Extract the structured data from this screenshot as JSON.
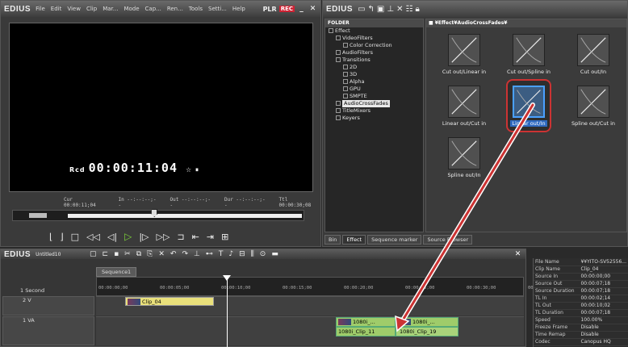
{
  "recorder": {
    "app_logo": "EDIUS",
    "menu": [
      "File",
      "Edit",
      "View",
      "Clip",
      "Mar...",
      "Mode",
      "Cap...",
      "Ren...",
      "Tools",
      "Setti...",
      "Help"
    ],
    "mode_label": "PLR",
    "rec_badge": "REC",
    "timecode_prefix": "Rcd",
    "timecode": "00:00:11:04",
    "timecode_suffix": "☆  ⏸",
    "cur": "Cur 00:00:11;04",
    "in": "In --:--:--;--",
    "out": "Out --:--:--;--",
    "dur": "Dur --:--:--;--",
    "ttl": "Ttl 00:00:30;08",
    "progress_fraction": 0.37
  },
  "effects": {
    "app_logo": "EDIUS",
    "folder_header": "FOLDER",
    "grid_header": "■ ¥Effect¥AudioCrossFades¥",
    "tree": [
      {
        "label": "Effect",
        "indent": 0
      },
      {
        "label": "VideoFilters",
        "indent": 1
      },
      {
        "label": "Color Correction",
        "indent": 2
      },
      {
        "label": "AudioFilters",
        "indent": 1
      },
      {
        "label": "Transitions",
        "indent": 1
      },
      {
        "label": "2D",
        "indent": 2
      },
      {
        "label": "3D",
        "indent": 2
      },
      {
        "label": "Alpha",
        "indent": 2
      },
      {
        "label": "GPU",
        "indent": 2
      },
      {
        "label": "SMPTE",
        "indent": 2
      },
      {
        "label": "AudioCrossFades",
        "indent": 1,
        "selected": true
      },
      {
        "label": "TitleMixers",
        "indent": 1
      },
      {
        "label": "Keyers",
        "indent": 1
      }
    ],
    "tiles": [
      {
        "label": "Cut out/Linear in"
      },
      {
        "label": "Cut out/Spline in"
      },
      {
        "label": "Cut out/In"
      },
      {
        "label": "Linear out/Cut in"
      },
      {
        "label": "Linear out/In",
        "selected": true
      },
      {
        "label": "Spline out/Cut in"
      },
      {
        "label": "Spline out/In"
      }
    ],
    "tabs": [
      "Bin",
      "Effect",
      "Sequence marker",
      "Source Browser"
    ]
  },
  "timeline": {
    "app_logo": "EDIUS",
    "project": "Untitled10",
    "sequence_tab": "Sequence1",
    "zoom": "1 Second",
    "ruler": [
      "00:00:00;00",
      "00:00:05;00",
      "00:00:10;00",
      "00:00:15;00",
      "00:00:20;00",
      "00:00:25;00",
      "00:00:30;00",
      "00:0"
    ],
    "tracks": [
      {
        "label": "2 V"
      },
      {
        "label": "1 VA"
      }
    ],
    "clips": [
      {
        "name": "Clip_04",
        "track": "2V"
      },
      {
        "name": "1080i_...",
        "track": "1VA-video-a"
      },
      {
        "name": "1080i_...",
        "track": "1VA-video-b"
      },
      {
        "name": "1080i_Clip_11",
        "track": "1VA-audio-a"
      },
      {
        "name": "1080i_Clip_19",
        "track": "1VA-audio-b"
      }
    ]
  },
  "info": [
    [
      "File Name",
      "¥¥YITO-SV52556..."
    ],
    [
      "Clip Name",
      "Clip_04"
    ],
    [
      "Source In",
      "00:00:00;00"
    ],
    [
      "Source Out",
      "00:00:07;18"
    ],
    [
      "Source Duration",
      "00:00:07;18"
    ],
    [
      "TL In",
      "00:00:02;14"
    ],
    [
      "TL Out",
      "00:00:10;02"
    ],
    [
      "TL Duration",
      "00:00:07;18"
    ],
    [
      "Speed",
      "100.00%"
    ],
    [
      "Freeze Frame",
      "Disable"
    ],
    [
      "Time Remap",
      "Disable"
    ],
    [
      "Codec",
      "Canopus HQ"
    ]
  ]
}
